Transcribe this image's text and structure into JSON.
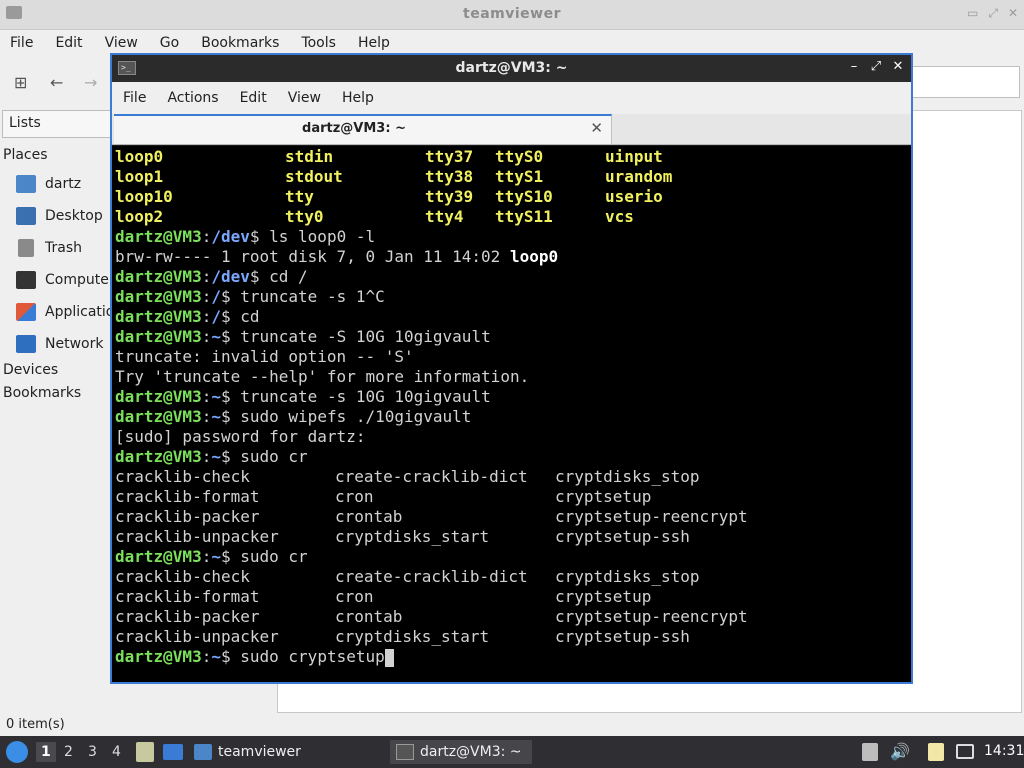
{
  "fm": {
    "title": "teamviewer",
    "menu": [
      "File",
      "Edit",
      "View",
      "Go",
      "Bookmarks",
      "Tools",
      "Help"
    ],
    "list_selector": "Lists",
    "places_heading": "Places",
    "places": [
      "dartz",
      "Desktop",
      "Trash",
      "Computer",
      "Applications",
      "Network"
    ],
    "devices_heading": "Devices",
    "bookmarks_heading": "Bookmarks",
    "status": "0 item(s)"
  },
  "terminal": {
    "title": "dartz@VM3: ~",
    "menu": [
      "File",
      "Actions",
      "Edit",
      "View",
      "Help"
    ],
    "tab_label": "dartz@VM3: ~",
    "dev_listing": [
      [
        "loop0",
        "stdin",
        "tty37",
        "ttyS0",
        "uinput"
      ],
      [
        "loop1",
        "stdout",
        "tty38",
        "ttyS1",
        "urandom"
      ],
      [
        "loop10",
        "tty",
        "tty39",
        "ttyS10",
        "userio"
      ],
      [
        "loop2",
        "tty0",
        "tty4",
        "ttyS11",
        "vcs"
      ]
    ],
    "prompt_user": "dartz@VM3",
    "lines": {
      "l5_path": "/dev",
      "l5_cmd": "$ ls loop0 -l",
      "l6_text": "brw-rw---- 1 root disk 7, 0 Jan 11 14:02 ",
      "l6_name": "loop0",
      "l7_path": "/dev",
      "l7_cmd": "$ cd /",
      "l8_path": "/",
      "l8_cmd": "$ truncate -s 1^C",
      "l9_path": "/",
      "l9_cmd": "$ cd",
      "l10_path": "~",
      "l10_cmd": "$ truncate -S 10G 10gigvault",
      "l11_text": "truncate: invalid option -- 'S'",
      "l12_text": "Try 'truncate --help' for more information.",
      "l13_path": "~",
      "l13_cmd": "$ truncate -s 10G 10gigvault",
      "l14_path": "~",
      "l14_cmd": "$ sudo wipefs ./10gigvault",
      "l15_text": "[sudo] password for dartz:",
      "l16_path": "~",
      "l16_cmd": "$ sudo cr",
      "l21_path": "~",
      "l21_cmd": "$ sudo cr",
      "l26_path": "~",
      "l26_cmd": "$ sudo cryptsetup"
    },
    "completions": [
      [
        "cracklib-check",
        "create-cracklib-dict",
        "cryptdisks_stop"
      ],
      [
        "cracklib-format",
        "cron",
        "cryptsetup"
      ],
      [
        "cracklib-packer",
        "crontab",
        "cryptsetup-reencrypt"
      ],
      [
        "cracklib-unpacker",
        "cryptdisks_start",
        "cryptsetup-ssh"
      ]
    ]
  },
  "panel": {
    "workspaces": [
      "1",
      "2",
      "3",
      "4"
    ],
    "task_fm": "teamviewer",
    "task_term": "dartz@VM3: ~",
    "clock": "14:31"
  },
  "colors": {
    "accent": "#3a7bd5",
    "prompt_green": "#7be05a",
    "path_blue": "#7aa6ff",
    "device_yellow": "#f0f060"
  }
}
